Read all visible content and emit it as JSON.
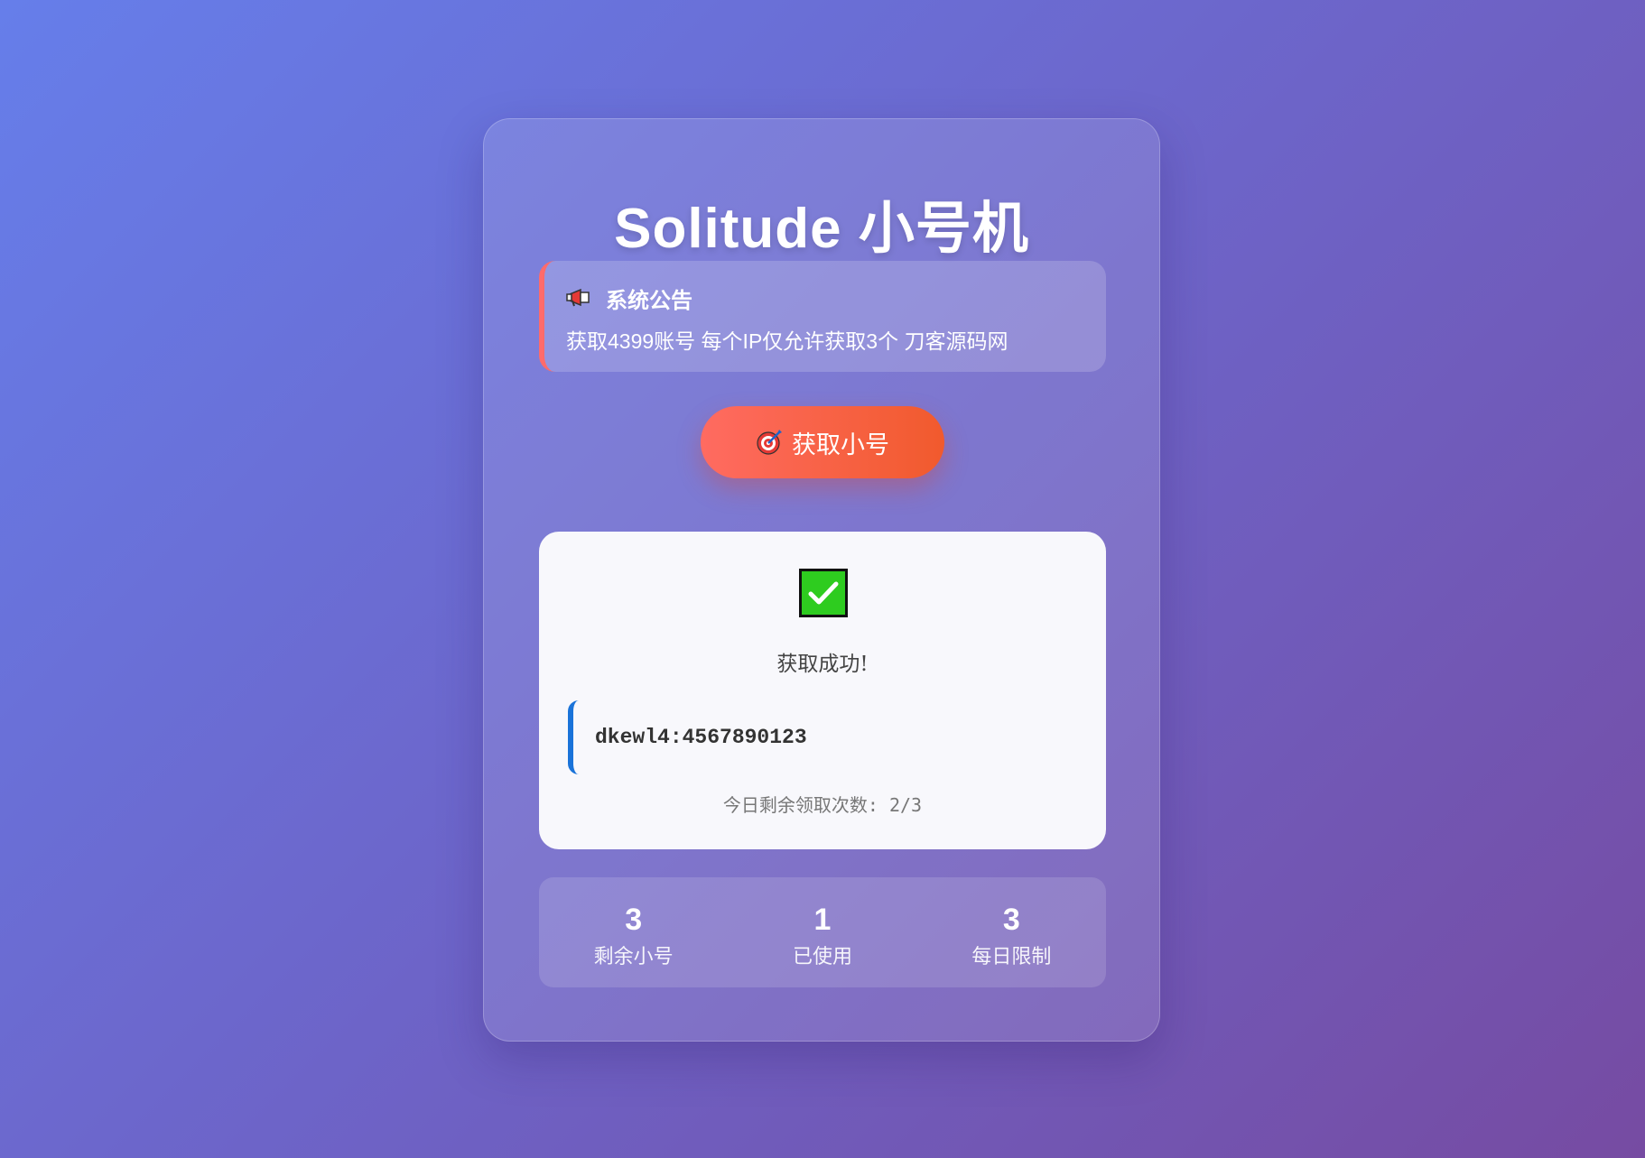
{
  "app": {
    "title": "Solitude 小号机"
  },
  "notice": {
    "icon": "megaphone-icon",
    "heading": "系统公告",
    "text": "获取4399账号 每个IP仅允许获取3个 刀客源码网",
    "accent_color": "#ff6b6b"
  },
  "action": {
    "icon": "target-icon",
    "label": "获取小号"
  },
  "result": {
    "icon": "check-mark-icon",
    "status": "获取成功!",
    "account": "dkewl4:4567890123",
    "remaining": "今日剩余领取次数: 2/3",
    "accent_color": "#1a73d9"
  },
  "stats": [
    {
      "value": "3",
      "label": "剩余小号"
    },
    {
      "value": "1",
      "label": "已使用"
    },
    {
      "value": "3",
      "label": "每日限制"
    }
  ]
}
